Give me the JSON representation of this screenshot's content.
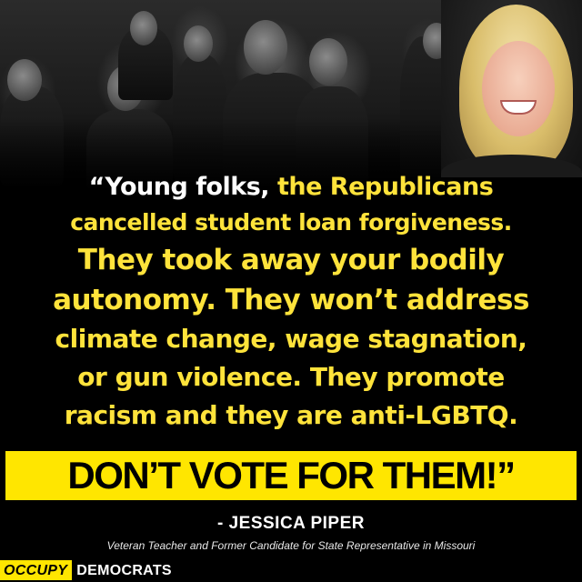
{
  "quote": {
    "line1": {
      "white": "“Young folks, ",
      "yellow": "the Republicans"
    },
    "line2": "cancelled student loan forgiveness.",
    "line3": "They took away your bodily",
    "line4": "autonomy. They won’t address",
    "line5": "climate change, wage stagnation,",
    "line6": "or gun violence. They promote",
    "line7": "racism and they are anti-LGBTQ."
  },
  "banner": {
    "text": "DON’T VOTE FOR THEM!”"
  },
  "attribution": {
    "name": "- JESSICA PIPER",
    "title": "Veteran Teacher and Former Candidate for State Representative in Missouri"
  },
  "logo": {
    "part1": "OCCUPY",
    "part2": "DEMOCRATS"
  },
  "colors": {
    "accent_yellow": "#ffe600",
    "quote_yellow": "#ffe33b",
    "background": "#000000"
  }
}
